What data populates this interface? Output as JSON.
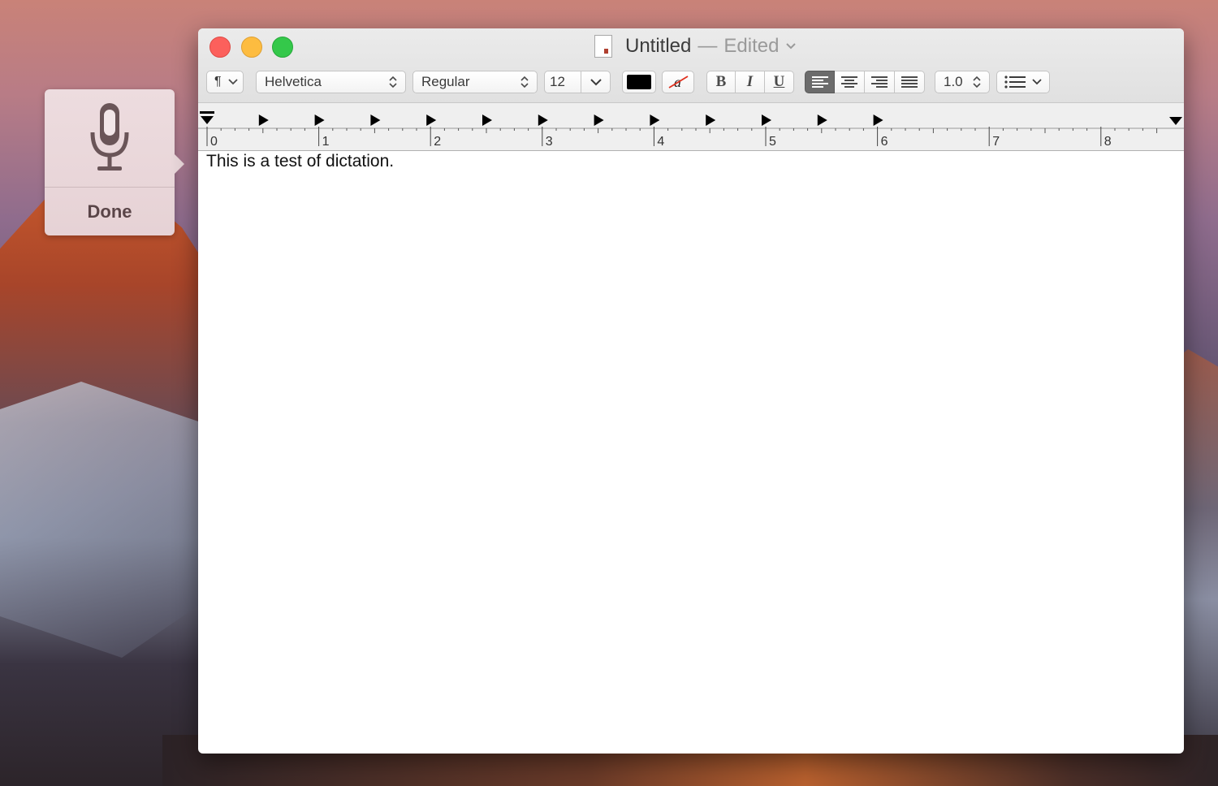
{
  "window": {
    "title": "Untitled",
    "separator": "—",
    "status": "Edited"
  },
  "dictation": {
    "done_label": "Done"
  },
  "toolbar": {
    "paragraph_icon": "¶",
    "font_family": "Helvetica",
    "font_style": "Regular",
    "font_size": "12",
    "text_color": "#000000",
    "bold_label": "B",
    "italic_label": "I",
    "underline_label": "U",
    "line_spacing": "1.0",
    "alignment_selected": "left"
  },
  "ruler": {
    "labels": [
      "0",
      "1",
      "2",
      "3",
      "4",
      "5",
      "6",
      "7",
      "8"
    ]
  },
  "document": {
    "text": "This is a test of dictation."
  }
}
